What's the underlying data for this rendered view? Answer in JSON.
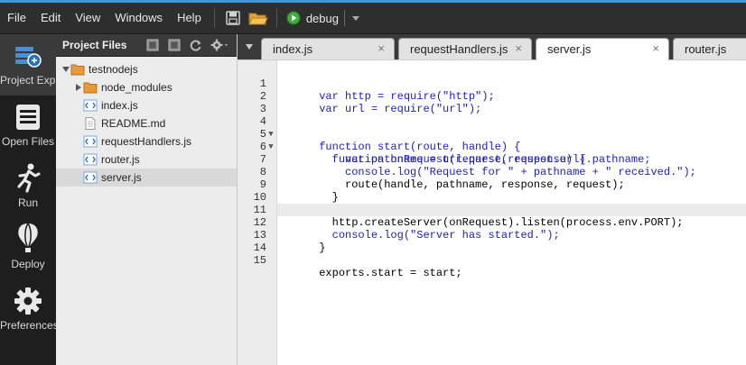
{
  "menu": [
    "File",
    "Edit",
    "View",
    "Windows",
    "Help"
  ],
  "toolbar": {
    "run_config": "debug",
    "icons": [
      "save-icon",
      "open-folder-icon",
      "run-icon"
    ]
  },
  "activity_bar": [
    {
      "label": "Project Explorer",
      "icon": "project-icon"
    },
    {
      "label": "Open Files",
      "icon": "list-icon"
    },
    {
      "label": "Run",
      "icon": "runner-icon"
    },
    {
      "label": "Deploy",
      "icon": "balloon-icon"
    },
    {
      "label": "Preferences",
      "icon": "gear-icon"
    }
  ],
  "sidebar": {
    "title": "Project Files",
    "tree": [
      {
        "name": "testnodejs",
        "kind": "folder",
        "depth": 0,
        "expanded": true
      },
      {
        "name": "node_modules",
        "kind": "folder",
        "depth": 1,
        "expanded": false
      },
      {
        "name": "index.js",
        "kind": "js",
        "depth": 1
      },
      {
        "name": "README.md",
        "kind": "file",
        "depth": 1
      },
      {
        "name": "requestHandlers.js",
        "kind": "js",
        "depth": 1
      },
      {
        "name": "router.js",
        "kind": "js",
        "depth": 1
      },
      {
        "name": "server.js",
        "kind": "js",
        "depth": 1,
        "selected": true
      }
    ]
  },
  "tabs": [
    {
      "label": "index.js",
      "active": false
    },
    {
      "label": "requestHandlers.js",
      "active": false
    },
    {
      "label": "server.js",
      "active": true
    },
    {
      "label": "router.js",
      "active": false
    }
  ],
  "editor": {
    "highlighted_line": 12,
    "lines": [
      "var http = require(\"http\");",
      "var url = require(\"url\");",
      "",
      "function start(route, handle) {",
      "  function onRequest(request, response) {",
      "    var pathname = url.parse(request.url).pathname;",
      "    console.log(\"Request for \" + pathname + \" received.\");",
      "    route(handle, pathname, response, request);",
      "  }",
      "",
      "  http.createServer(onRequest).listen(process.env.PORT);",
      "  console.log(\"Server has started.\");",
      "}",
      "",
      "exports.start = start;"
    ]
  }
}
